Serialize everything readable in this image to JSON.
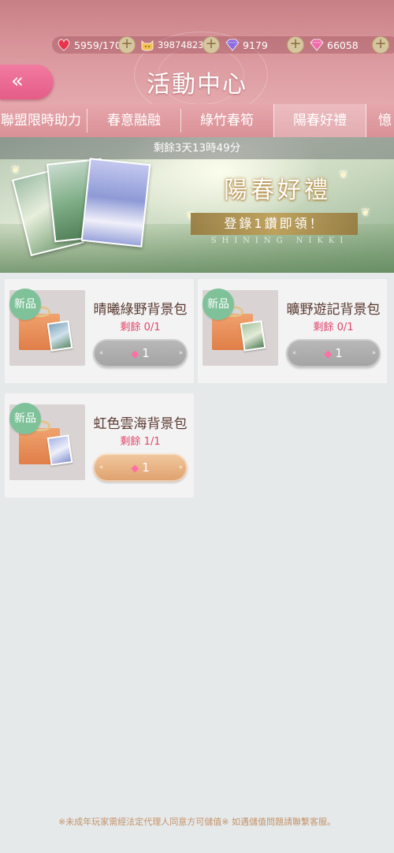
{
  "header": {
    "title": "活動中心",
    "resources": [
      {
        "icon": "heart-stamina-icon",
        "value": "5959/170"
      },
      {
        "icon": "gold-coin-cat-icon",
        "value": "39874823"
      },
      {
        "icon": "purple-diamond-icon",
        "value": "9179"
      },
      {
        "icon": "pink-diamond-icon",
        "value": "66058"
      }
    ]
  },
  "tabs": [
    {
      "label": "聯盟限時助力"
    },
    {
      "label": "春意融融"
    },
    {
      "label": "綠竹春筍"
    },
    {
      "label": "陽春好禮",
      "active": true
    },
    {
      "label": "憶"
    }
  ],
  "banner": {
    "timer": "剩餘3天13時49分",
    "title": "陽春好禮",
    "subtitle": "登錄1鑽即領！",
    "brand": "SHINING NIKKI"
  },
  "items": [
    {
      "badge": "新品",
      "name": "晴曦綠野背景包",
      "remain": "剩餘 0/1",
      "price": "1",
      "available": false
    },
    {
      "badge": "新品",
      "name": "曠野遊記背景包",
      "remain": "剩餘 0/1",
      "price": "1",
      "available": false
    },
    {
      "badge": "新品",
      "name": "虹色雲海背景包",
      "remain": "剩餘 1/1",
      "price": "1",
      "available": true
    }
  ],
  "footer": {
    "note": "※未成年玩家需經法定代理人同意方可儲值※ 如遇儲值問題請聯繫客服。"
  },
  "colors": {
    "header": "#d8959a",
    "back_button": "#ec6b93",
    "badge": "#7fc29a",
    "remain_text": "#e0466b",
    "button_active": "#dea06c",
    "button_disabled": "#a3a3a3"
  }
}
